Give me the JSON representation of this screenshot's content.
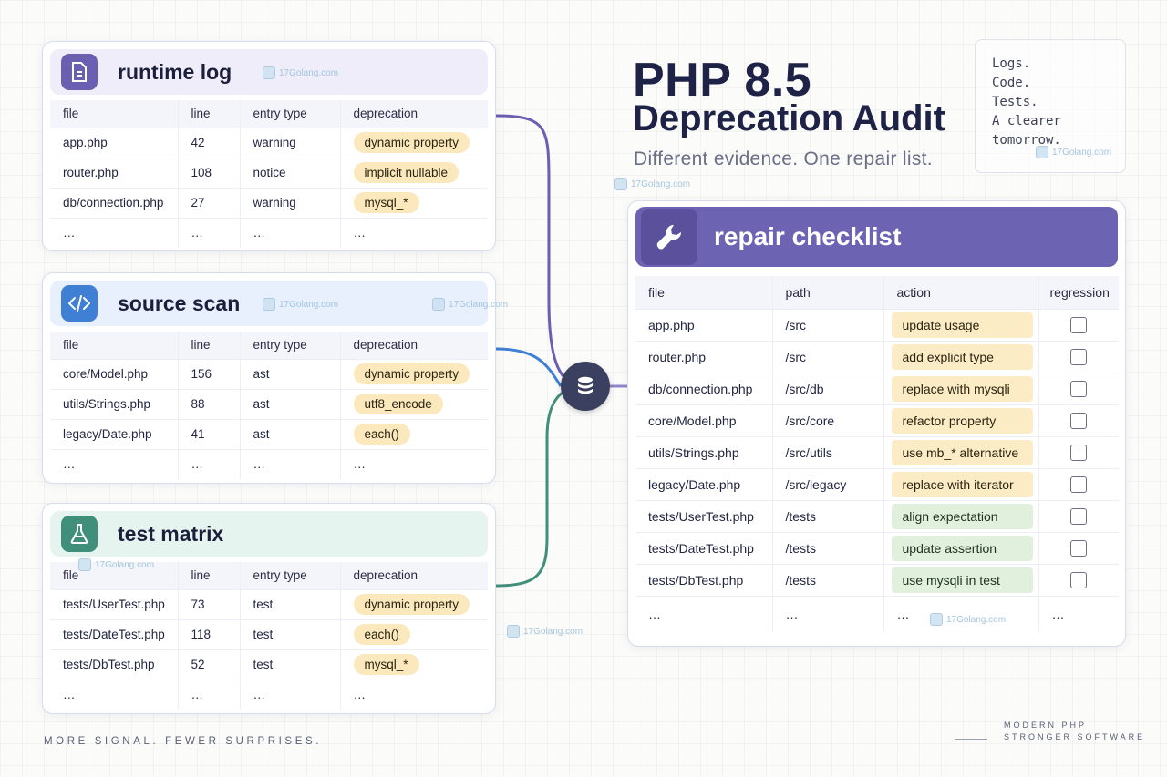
{
  "header": {
    "title_line1": "PHP 8.5",
    "title_line2": "Deprecation Audit",
    "subtitle": "Different evidence. One repair list."
  },
  "note": {
    "lines": [
      "Logs.",
      "Code.",
      "Tests.",
      "A clearer tomorrow."
    ]
  },
  "sources": [
    {
      "title": "runtime log",
      "icon": "document-icon",
      "color": "#6a5fb0",
      "columns": [
        "file",
        "line",
        "entry type",
        "deprecation"
      ],
      "rows": [
        [
          "app.php",
          "42",
          "warning",
          "dynamic property"
        ],
        [
          "router.php",
          "108",
          "notice",
          "implicit nullable"
        ],
        [
          "db/connection.php",
          "27",
          "warning",
          "mysql_*"
        ],
        [
          "…",
          "…",
          "…",
          "…"
        ]
      ]
    },
    {
      "title": "source scan",
      "icon": "code-icon",
      "color": "#3f7fd4",
      "columns": [
        "file",
        "line",
        "entry type",
        "deprecation"
      ],
      "rows": [
        [
          "core/Model.php",
          "156",
          "ast",
          "dynamic property"
        ],
        [
          "utils/Strings.php",
          "88",
          "ast",
          "utf8_encode"
        ],
        [
          "legacy/Date.php",
          "41",
          "ast",
          "each()"
        ],
        [
          "…",
          "…",
          "…",
          "…"
        ]
      ]
    },
    {
      "title": "test matrix",
      "icon": "flask-icon",
      "color": "#3f8f7a",
      "columns": [
        "file",
        "line",
        "entry type",
        "deprecation"
      ],
      "rows": [
        [
          "tests/UserTest.php",
          "73",
          "test",
          "dynamic property"
        ],
        [
          "tests/DateTest.php",
          "118",
          "test",
          "each()"
        ],
        [
          "tests/DbTest.php",
          "52",
          "test",
          "mysql_*"
        ],
        [
          "…",
          "…",
          "…",
          "…"
        ]
      ]
    }
  ],
  "repair": {
    "title": "repair checklist",
    "icon": "wrench-icon",
    "columns": [
      "file",
      "path",
      "action",
      "regression"
    ],
    "rows": [
      {
        "file": "app.php",
        "path": "/src",
        "action": "update usage",
        "tone": "amber"
      },
      {
        "file": "router.php",
        "path": "/src",
        "action": "add explicit type",
        "tone": "amber"
      },
      {
        "file": "db/connection.php",
        "path": "/src/db",
        "action": "replace with mysqli",
        "tone": "amber"
      },
      {
        "file": "core/Model.php",
        "path": "/src/core",
        "action": "refactor property",
        "tone": "amber"
      },
      {
        "file": "utils/Strings.php",
        "path": "/src/utils",
        "action": "use mb_* alternative",
        "tone": "amber"
      },
      {
        "file": "legacy/Date.php",
        "path": "/src/legacy",
        "action": "replace with iterator",
        "tone": "amber"
      },
      {
        "file": "tests/UserTest.php",
        "path": "/tests",
        "action": "align expectation",
        "tone": "green"
      },
      {
        "file": "tests/DateTest.php",
        "path": "/tests",
        "action": "update assertion",
        "tone": "green"
      },
      {
        "file": "tests/DbTest.php",
        "path": "/tests",
        "action": "use mysqli in test",
        "tone": "green"
      },
      {
        "file": "…",
        "path": "…",
        "action": "…",
        "tone": "none"
      }
    ]
  },
  "footer": {
    "left": "MORE SIGNAL. FEWER SURPRISES.",
    "right_line1": "MODERN PHP",
    "right_line2": "STRONGER SOFTWARE"
  },
  "watermark": "17Golang.com",
  "colors": {
    "runtime": "#6a5fb0",
    "scan": "#3f7fd4",
    "tests": "#3f8f7a",
    "repair": "#6d63b3",
    "hub": "#3c4060"
  }
}
